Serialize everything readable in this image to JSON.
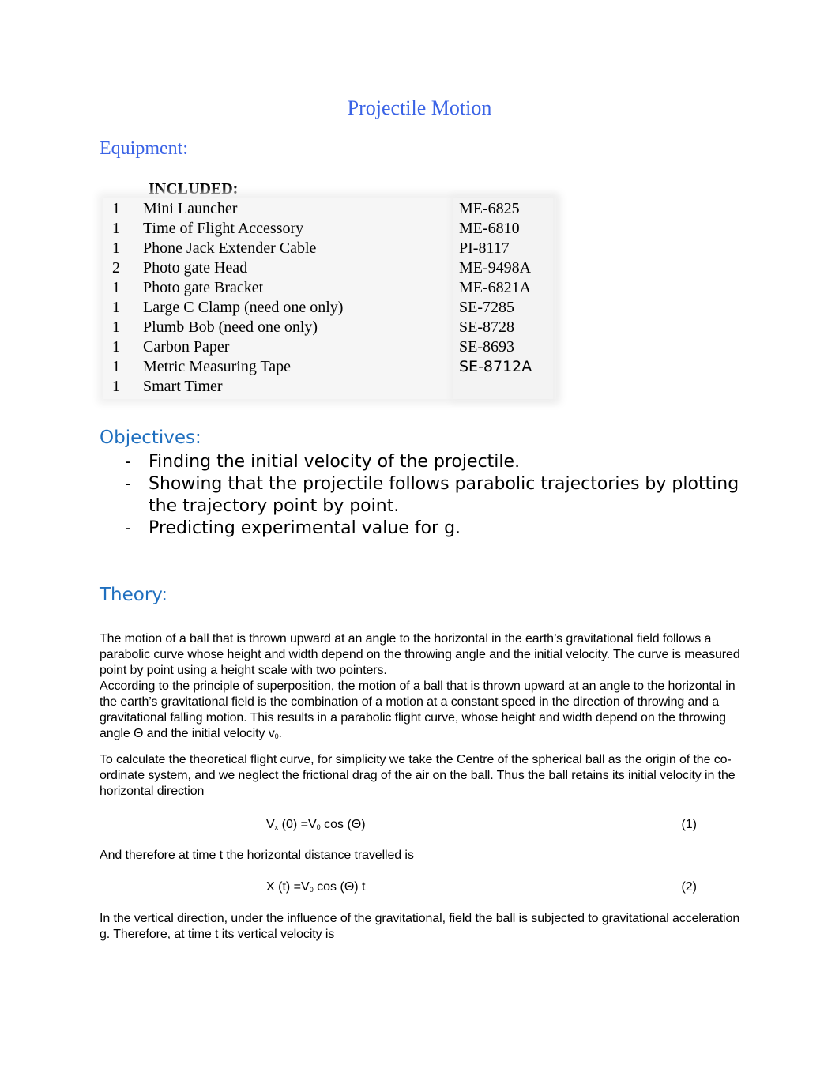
{
  "document": {
    "title": "Projectile Motion"
  },
  "equipment": {
    "heading": "Equipment:",
    "included_label": "INCLUDED:",
    "items": [
      {
        "qty": "1",
        "name": "Mini Launcher",
        "code": "ME-6825"
      },
      {
        "qty": "1",
        "name": "Time of Flight Accessory",
        "code": "ME-6810"
      },
      {
        "qty": "1",
        "name": "Phone Jack Extender Cable",
        "code": "PI-8117"
      },
      {
        "qty": "2",
        "name": "Photo gate Head",
        "code": "ME-9498A"
      },
      {
        "qty": "1",
        "name": "Photo gate Bracket",
        "code": "ME-6821A"
      },
      {
        "qty": "1",
        "name": "Large C Clamp (need one only)",
        "code": "SE-7285"
      },
      {
        "qty": "1",
        "name": "Plumb Bob (need one only)",
        "code": "SE-8728"
      },
      {
        "qty": "1",
        "name": "Carbon Paper",
        "code": "SE-8693"
      },
      {
        "qty": "1",
        "name": "Metric Measuring Tape",
        "code": "SE-8712A"
      },
      {
        "qty": "1",
        "name": "Smart Timer",
        "code": ""
      }
    ]
  },
  "objectives": {
    "heading": "Objectives:",
    "bullet": "-",
    "items": [
      "Finding the initial velocity of the projectile.",
      "Showing that the projectile follows parabolic trajectories by plotting the trajectory point by point.",
      "Predicting experimental value for g."
    ]
  },
  "theory": {
    "heading": "Theory:",
    "p1": "The motion of a ball that is thrown upward at an angle to the horizontal in the earth’s gravitational field follows a parabolic curve whose height and width depend on the throwing angle and the initial velocity. The curve is measured point by point using a height scale with two pointers.",
    "p2_main": "According to the principle of superposition, the motion of a ball that is thrown upward at an angle to the horizontal in the earth’s gravitational field is the combination of a motion at a constant speed in the direction of throwing and a gravitational falling motion. This results in a parabolic flight curve, whose height and width depend on the throwing angle Θ and the initial velocity v",
    "p2_sub": "0",
    "p2_end": ".",
    "p3": "To calculate the theoretical flight curve, for simplicity we take the Centre of the spherical ball as the origin of the co-ordinate system, and we neglect the frictional drag of the air on the ball. Thus the ball retains its initial velocity in the horizontal direction",
    "eq1": {
      "a": "V",
      "a_sub": "x",
      "b": " (0) =V",
      "b_sub": "0",
      "c": " cos (Θ)",
      "num": "(1)"
    },
    "p4": "And therefore at time t the horizontal distance travelled is",
    "eq2": {
      "a": "X (t) =V",
      "a_sub": "0",
      "b": " cos (Θ) t",
      "num": "(2)"
    },
    "p5": "In the vertical direction, under the influence of the gravitational, field the ball is subjected to gravitational acceleration g. Therefore, at time t its vertical velocity is"
  }
}
